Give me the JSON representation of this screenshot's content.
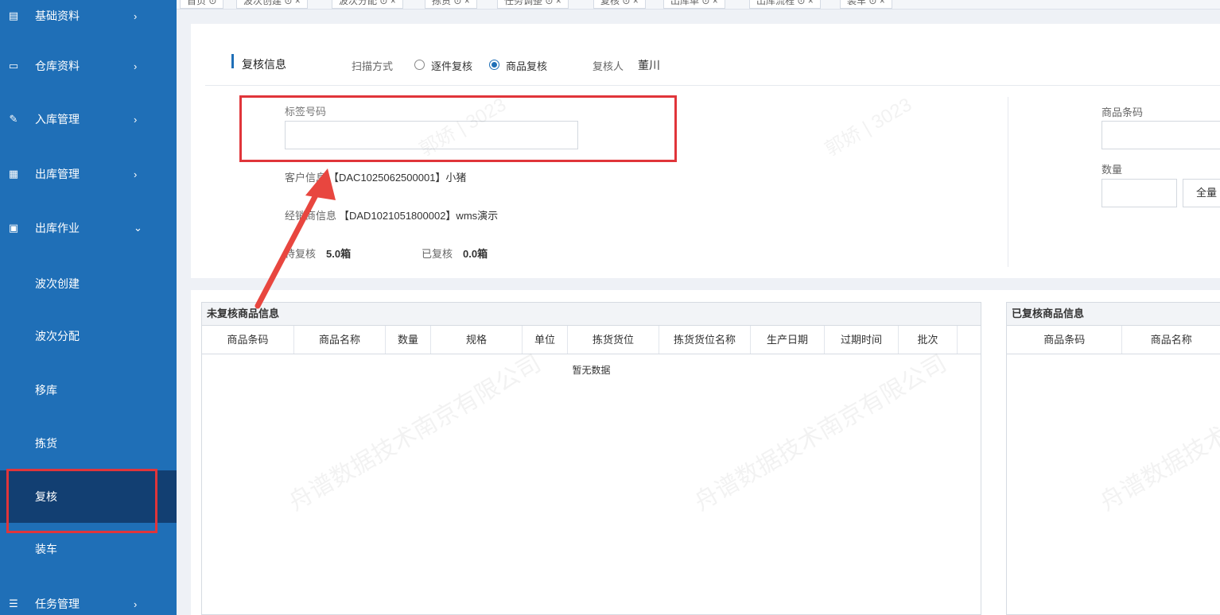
{
  "sidebar": {
    "items": [
      {
        "label": "基础资料",
        "icon": "book-icon"
      },
      {
        "label": "仓库资料",
        "icon": "inbox-icon"
      },
      {
        "label": "入库管理",
        "icon": "import-icon"
      },
      {
        "label": "出库管理",
        "icon": "grid-icon"
      },
      {
        "label": "出库作业",
        "icon": "calculator-icon"
      }
    ],
    "sub_items": [
      "波次创建",
      "波次分配",
      "移库",
      "拣货",
      "复核",
      "装车"
    ],
    "bottom_item": {
      "label": "任务管理",
      "icon": "server-icon"
    },
    "arrow_right": "›",
    "arrow_down": "⌄"
  },
  "tabs": [
    "首页",
    "波次创建",
    "波次分配",
    "拣货",
    "任务调整",
    "复核",
    "出库单",
    "出库流程",
    "装车"
  ],
  "review": {
    "title": "复核信息",
    "scan_mode_label": "扫描方式",
    "option_piece": "逐件复核",
    "option_goods": "商品复核",
    "reviewer_label": "复核人",
    "reviewer_name": "董川",
    "tag_label": "标签号码",
    "customer_label": "客户信息",
    "customer_value": "【DAC1025062500001】小猪",
    "dealer_label": "经销商信息",
    "dealer_value": "【DAD1021051800002】wms演示",
    "pending_label": "待复核",
    "pending_value": "5.0箱",
    "done_label": "已复核",
    "done_value": "0.0箱",
    "barcode_label": "商品条码",
    "qty_label": "数量",
    "all_button": "全量"
  },
  "unreviewed": {
    "title": "未复核商品信息",
    "columns": [
      "商品条码",
      "商品名称",
      "数量",
      "规格",
      "单位",
      "拣货货位",
      "拣货货位名称",
      "生产日期",
      "过期时间",
      "批次"
    ],
    "empty_text": "暂无数据"
  },
  "reviewed": {
    "title": "已复核商品信息",
    "columns": [
      "商品条码",
      "商品名称"
    ]
  },
  "watermarks": [
    "郭娇 | 3023",
    "舟谱数据技术南京有限公司"
  ]
}
